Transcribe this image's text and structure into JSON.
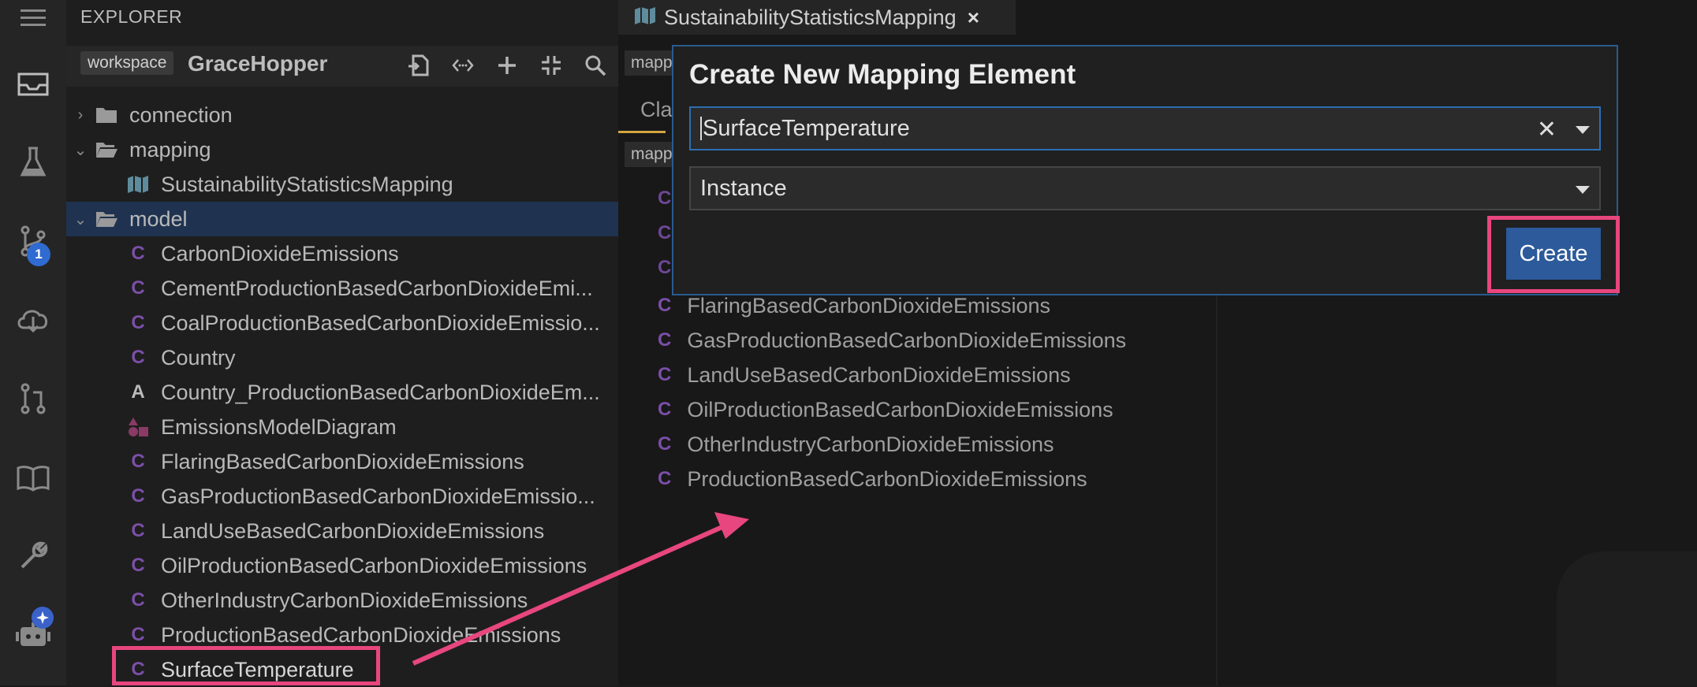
{
  "explorer": {
    "title": "EXPLORER",
    "workspace_tag": "workspace",
    "workspace_name": "GraceHopper",
    "tree": [
      {
        "type": "folder",
        "label": "connection",
        "expanded": false
      },
      {
        "type": "folder",
        "label": "mapping",
        "expanded": true
      },
      {
        "type": "mapping",
        "label": "SustainabilityStatisticsMapping"
      },
      {
        "type": "folder",
        "label": "model",
        "expanded": true,
        "selected": true
      },
      {
        "type": "class",
        "label": "CarbonDioxideEmissions"
      },
      {
        "type": "class",
        "label": "CementProductionBasedCarbonDioxideEmi..."
      },
      {
        "type": "class",
        "label": "CoalProductionBasedCarbonDioxideEmissio..."
      },
      {
        "type": "class",
        "label": "Country"
      },
      {
        "type": "association",
        "label": "Country_ProductionBasedCarbonDioxideEm..."
      },
      {
        "type": "diagram",
        "label": "EmissionsModelDiagram"
      },
      {
        "type": "class",
        "label": "FlaringBasedCarbonDioxideEmissions"
      },
      {
        "type": "class",
        "label": "GasProductionBasedCarbonDioxideEmissio..."
      },
      {
        "type": "class",
        "label": "LandUseBasedCarbonDioxideEmissions"
      },
      {
        "type": "class",
        "label": "OilProductionBasedCarbonDioxideEmissions"
      },
      {
        "type": "class",
        "label": "OtherIndustryCarbonDioxideEmissions"
      },
      {
        "type": "class",
        "label": "ProductionBasedCarbonDioxideEmissions"
      },
      {
        "type": "class",
        "label": "SurfaceTemperature",
        "highlighted": true
      }
    ]
  },
  "activity_bar": {
    "icons": [
      "menu-icon",
      "inbox-icon",
      "flask-icon",
      "source-control-icon",
      "cloud-icon",
      "pull-request-icon",
      "book-icon",
      "wrench-icon",
      "robot-icon"
    ],
    "source_control_badge": "1"
  },
  "editor": {
    "tab_label": "SustainabilityStatisticsMapping",
    "breadcrumb_top": "mapp",
    "subtab_partial": "Cla",
    "breadcrumb_mid": "mapp",
    "class_list": [
      "FlaringBasedCarbonDioxideEmissions",
      "GasProductionBasedCarbonDioxideEmissions",
      "LandUseBasedCarbonDioxideEmissions",
      "OilProductionBasedCarbonDioxideEmissions",
      "OtherIndustryCarbonDioxideEmissions",
      "ProductionBasedCarbonDioxideEmissions"
    ]
  },
  "modal": {
    "title": "Create New Mapping Element",
    "name_value": "SurfaceTemperature",
    "type_value": "Instance",
    "create_label": "Create"
  },
  "colors": {
    "accent": "#2c5a9a",
    "highlight": "#e8467e",
    "class_icon": "#7b4fa8"
  }
}
